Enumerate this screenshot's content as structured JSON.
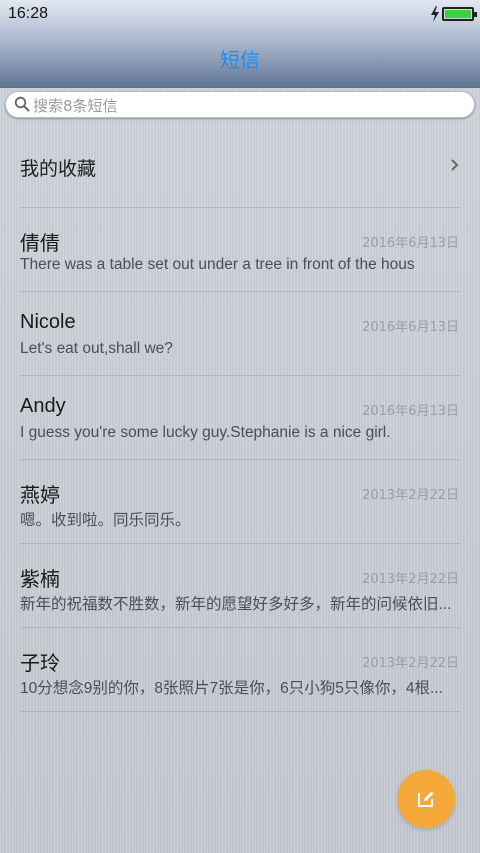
{
  "status_bar": {
    "time": "16:28"
  },
  "header": {
    "title": "短信"
  },
  "search": {
    "placeholder": "搜索8条短信"
  },
  "favorites": {
    "label": "我的收藏"
  },
  "messages": [
    {
      "name": "倩倩",
      "date": "2016年6月13日",
      "preview": "There was a table set out under a tree in front of the hous"
    },
    {
      "name": "Nicole",
      "date": "2016年6月13日",
      "preview": "Let's eat out,shall we?"
    },
    {
      "name": "Andy",
      "date": "2016年6月13日",
      "preview": "I guess you're some lucky guy.Stephanie is a nice girl."
    },
    {
      "name": "燕婷",
      "date": "2013年2月22日",
      "preview": "嗯。收到啦。同乐同乐。"
    },
    {
      "name": "紫楠",
      "date": "2013年2月22日",
      "preview": "新年的祝福数不胜数，新年的愿望好多好多，新年的问候依旧..."
    },
    {
      "name": "子玲",
      "date": "2013年2月22日",
      "preview": "10分想念9别的你，8张照片7张是你，6只小狗5只像你，4根..."
    }
  ],
  "colors": {
    "accent": "#1e8cf0",
    "fab": "#f6a93b",
    "battery": "#3bd33b"
  },
  "icons": {
    "search": "search-icon",
    "chevron": "chevron-right-icon",
    "compose": "compose-icon",
    "battery": "battery-icon",
    "charging": "bolt-icon"
  }
}
